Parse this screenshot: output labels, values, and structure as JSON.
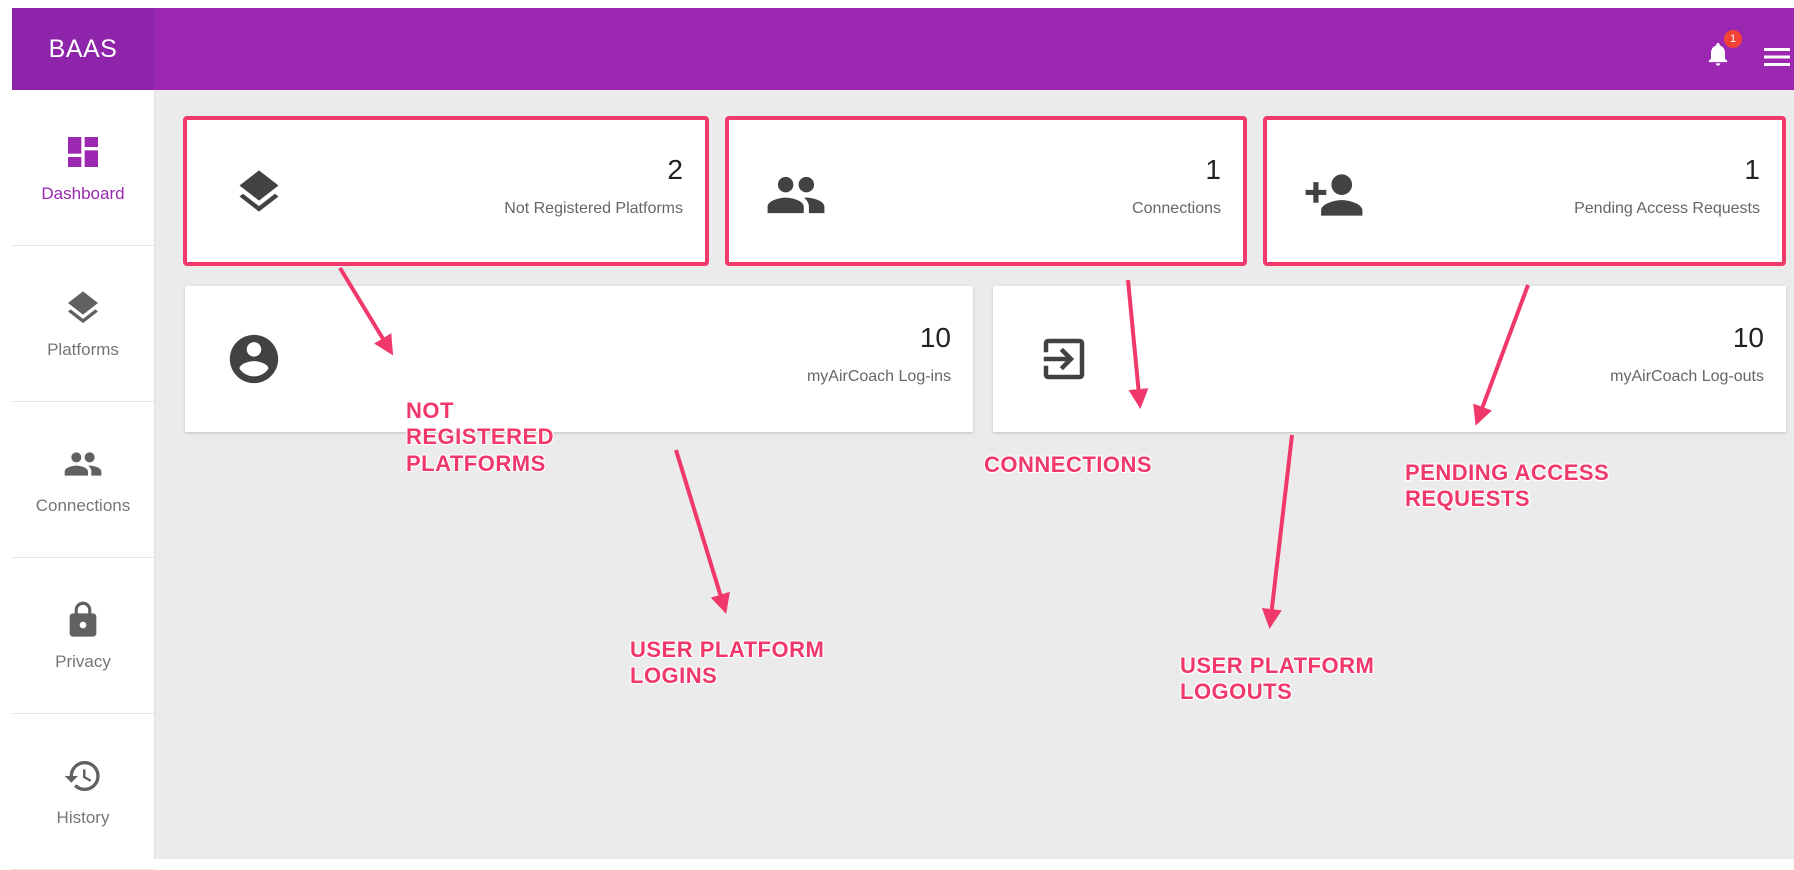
{
  "header": {
    "brand": "BAAS",
    "notification_count": "1",
    "brand_color": "#9c27b0"
  },
  "sidebar": {
    "items": [
      {
        "label": "Dashboard",
        "icon": "dashboard-icon",
        "active": true
      },
      {
        "label": "Platforms",
        "icon": "layers-icon"
      },
      {
        "label": "Connections",
        "icon": "people-icon"
      },
      {
        "label": "Privacy",
        "icon": "lock-icon"
      },
      {
        "label": "History",
        "icon": "history-icon"
      }
    ]
  },
  "cards": {
    "not_registered": {
      "value": "2",
      "label": "Not Registered Platforms",
      "icon": "layers-icon"
    },
    "connections": {
      "value": "1",
      "label": "Connections",
      "icon": "people-icon"
    },
    "pending": {
      "value": "1",
      "label": "Pending Access Requests",
      "icon": "person-add-icon"
    },
    "logins": {
      "value": "10",
      "label": "myAirCoach Log-ins",
      "icon": "account-circle-icon"
    },
    "logouts": {
      "value": "10",
      "label": "myAirCoach Log-outs",
      "icon": "login-arrow-icon"
    }
  },
  "annotations": {
    "not_registered": [
      "NOT",
      "REGISTERED",
      "PLATFORMS"
    ],
    "connections": "CONNECTIONS",
    "pending": [
      "PENDING ACCESS",
      "REQUESTS"
    ],
    "logins": [
      "USER PLATFORM",
      "LOGINS"
    ],
    "logouts": [
      "USER PLATFORM",
      "LOGOUTS"
    ],
    "color": "#f0386b"
  }
}
